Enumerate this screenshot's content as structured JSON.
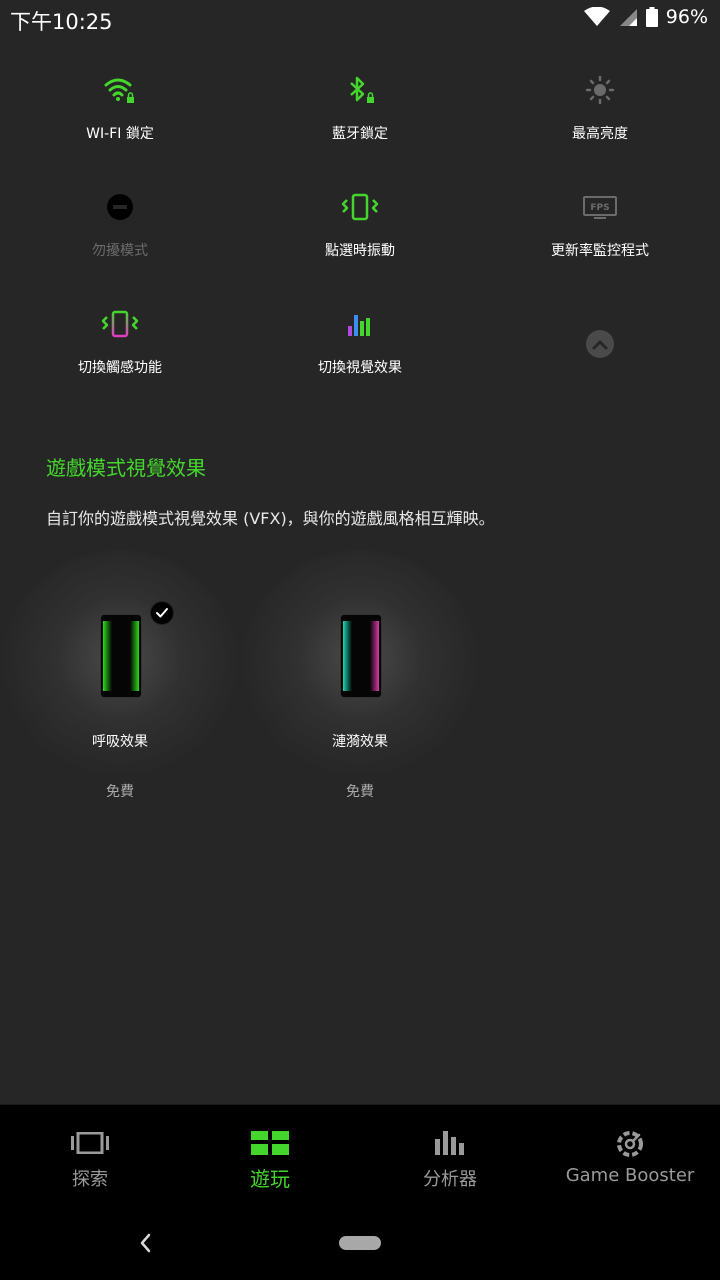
{
  "status": {
    "time": "下午10:25",
    "battery": "96%"
  },
  "tiles": [
    {
      "label": "WI-FI 鎖定",
      "icon": "wifi-lock-icon"
    },
    {
      "label": "藍牙鎖定",
      "icon": "bluetooth-lock-icon"
    },
    {
      "label": "最高亮度",
      "icon": "brightness-icon"
    },
    {
      "label": "勿擾模式",
      "icon": "do-not-disturb-icon"
    },
    {
      "label": "點選時振動",
      "icon": "vibrate-icon"
    },
    {
      "label": "更新率監控程式",
      "icon": "fps-icon"
    },
    {
      "label": "切換觸感功能",
      "icon": "haptics-icon"
    },
    {
      "label": "切換視覺效果",
      "icon": "visual-effects-icon"
    }
  ],
  "section": {
    "title": "遊戲模式視覺效果",
    "description": "自訂你的遊戲模式視覺效果 (VFX)，與你的遊戲風格相互輝映。"
  },
  "vfx": [
    {
      "name": "呼吸效果",
      "price": "免費",
      "selected": true
    },
    {
      "name": "漣漪效果",
      "price": "免費",
      "selected": false
    }
  ],
  "nav": [
    {
      "label": "探索",
      "icon": "explore-icon"
    },
    {
      "label": "遊玩",
      "icon": "play-grid-icon",
      "active": true
    },
    {
      "label": "分析器",
      "icon": "analyzer-icon"
    },
    {
      "label": "Game Booster",
      "icon": "game-booster-icon"
    }
  ],
  "colors": {
    "accent": "#44d62c",
    "background": "#262626",
    "nav_background": "#000000"
  }
}
